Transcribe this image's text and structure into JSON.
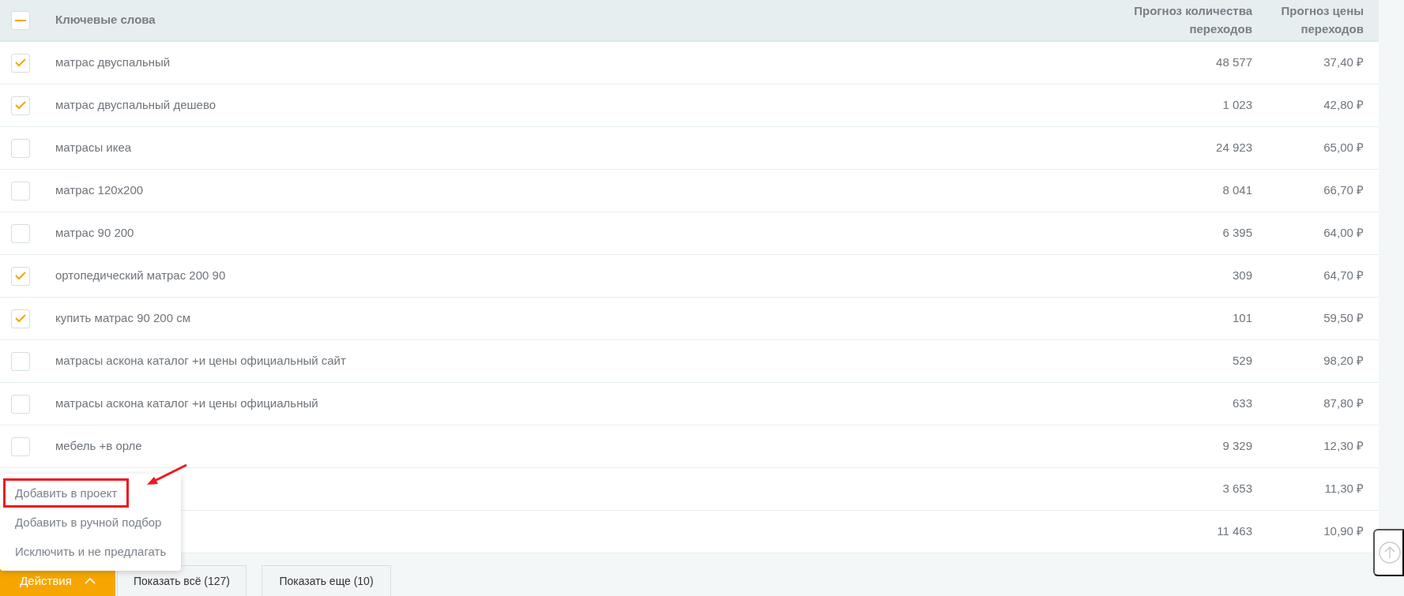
{
  "table": {
    "header_checkbox": {
      "indeterminate": true
    },
    "columns": [
      "Ключевые слова",
      "Прогноз количества переходов",
      "Прогноз цены переходов"
    ],
    "rows": [
      {
        "checked": true,
        "keyword": "матрас двуспальный",
        "clicks": "48 577",
        "price": "37,40 ₽"
      },
      {
        "checked": true,
        "keyword": "матрас двуспальный дешево",
        "clicks": "1 023",
        "price": "42,80 ₽"
      },
      {
        "checked": false,
        "keyword": "матрасы икеа",
        "clicks": "24 923",
        "price": "65,00 ₽"
      },
      {
        "checked": false,
        "keyword": "матрас 120х200",
        "clicks": "8 041",
        "price": "66,70 ₽"
      },
      {
        "checked": false,
        "keyword": "матрас 90 200",
        "clicks": "6 395",
        "price": "64,00 ₽"
      },
      {
        "checked": true,
        "keyword": "ортопедический матрас 200 90",
        "clicks": "309",
        "price": "64,70 ₽"
      },
      {
        "checked": true,
        "keyword": "купить матрас 90 200 см",
        "clicks": "101",
        "price": "59,50 ₽"
      },
      {
        "checked": false,
        "keyword": "матрасы аскона каталог +и цены официальный сайт",
        "clicks": "529",
        "price": "98,20 ₽"
      },
      {
        "checked": false,
        "keyword": "матрасы аскона каталог +и цены официальный",
        "clicks": "633",
        "price": "87,80 ₽"
      },
      {
        "checked": false,
        "keyword": "мебель +в орле",
        "clicks": "9 329",
        "price": "12,30 ₽"
      },
      {
        "clicks": "3 653",
        "price": "11,30 ₽"
      },
      {
        "clicks": "11 463",
        "price": "10,90 ₽"
      }
    ]
  },
  "actions_menu": {
    "expanded": true,
    "items": [
      {
        "label": "Добавить в проект",
        "highlighted": true
      },
      {
        "label": "Добавить в ручной подбор",
        "highlighted": false
      },
      {
        "label": "Исключить и не предлагать",
        "highlighted": false
      }
    ]
  },
  "footer": {
    "actions_button": "Действия",
    "buttons": [
      "Показать всё (127)",
      "Показать еще (10)"
    ]
  }
}
